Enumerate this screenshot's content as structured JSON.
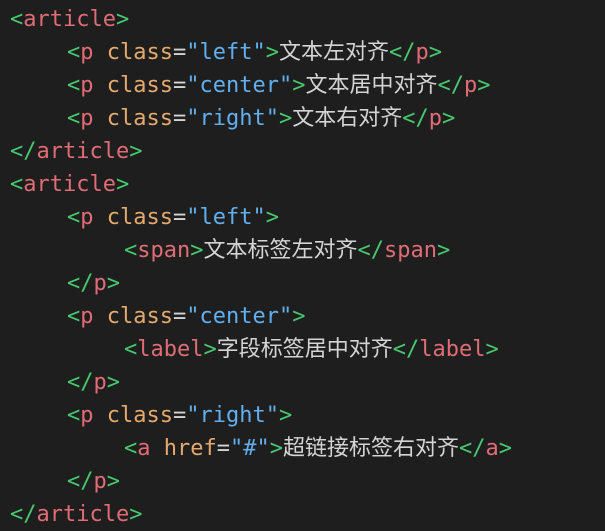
{
  "colors": {
    "background": "#1e1e1e",
    "bracket": "#47c96e",
    "tag_name": "#e06c75",
    "attribute": "#e5a96b",
    "string": "#61afef",
    "text": "#d4d4d4"
  },
  "lines": [
    {
      "indent": 0,
      "tokens": [
        {
          "type": "punct",
          "text": "<"
        },
        {
          "type": "tag",
          "text": "article"
        },
        {
          "type": "punct",
          "text": ">"
        }
      ]
    },
    {
      "indent": 1,
      "tokens": [
        {
          "type": "punct",
          "text": "<"
        },
        {
          "type": "tag",
          "text": "p"
        },
        {
          "type": "text",
          "text": " "
        },
        {
          "type": "attr",
          "text": "class"
        },
        {
          "type": "eq",
          "text": "="
        },
        {
          "type": "str",
          "text": "\"left\""
        },
        {
          "type": "punct",
          "text": ">"
        },
        {
          "type": "text",
          "text": "文本左对齐"
        },
        {
          "type": "punct",
          "text": "</"
        },
        {
          "type": "tag",
          "text": "p"
        },
        {
          "type": "punct",
          "text": ">"
        }
      ]
    },
    {
      "indent": 1,
      "tokens": [
        {
          "type": "punct",
          "text": "<"
        },
        {
          "type": "tag",
          "text": "p"
        },
        {
          "type": "text",
          "text": " "
        },
        {
          "type": "attr",
          "text": "class"
        },
        {
          "type": "eq",
          "text": "="
        },
        {
          "type": "str",
          "text": "\"center\""
        },
        {
          "type": "punct",
          "text": ">"
        },
        {
          "type": "text",
          "text": "文本居中对齐"
        },
        {
          "type": "punct",
          "text": "</"
        },
        {
          "type": "tag",
          "text": "p"
        },
        {
          "type": "punct",
          "text": ">"
        }
      ]
    },
    {
      "indent": 1,
      "tokens": [
        {
          "type": "punct",
          "text": "<"
        },
        {
          "type": "tag",
          "text": "p"
        },
        {
          "type": "text",
          "text": " "
        },
        {
          "type": "attr",
          "text": "class"
        },
        {
          "type": "eq",
          "text": "="
        },
        {
          "type": "str",
          "text": "\"right\""
        },
        {
          "type": "punct",
          "text": ">"
        },
        {
          "type": "text",
          "text": "文本右对齐"
        },
        {
          "type": "punct",
          "text": "</"
        },
        {
          "type": "tag",
          "text": "p"
        },
        {
          "type": "punct",
          "text": ">"
        }
      ]
    },
    {
      "indent": 0,
      "tokens": [
        {
          "type": "punct",
          "text": "</"
        },
        {
          "type": "tag",
          "text": "article"
        },
        {
          "type": "punct",
          "text": ">"
        }
      ]
    },
    {
      "indent": 0,
      "tokens": [
        {
          "type": "punct",
          "text": "<"
        },
        {
          "type": "tag",
          "text": "article"
        },
        {
          "type": "punct",
          "text": ">"
        }
      ]
    },
    {
      "indent": 1,
      "tokens": [
        {
          "type": "punct",
          "text": "<"
        },
        {
          "type": "tag",
          "text": "p"
        },
        {
          "type": "text",
          "text": " "
        },
        {
          "type": "attr",
          "text": "class"
        },
        {
          "type": "eq",
          "text": "="
        },
        {
          "type": "str",
          "text": "\"left\""
        },
        {
          "type": "punct",
          "text": ">"
        }
      ]
    },
    {
      "indent": 2,
      "tokens": [
        {
          "type": "punct",
          "text": "<"
        },
        {
          "type": "tag",
          "text": "span"
        },
        {
          "type": "punct",
          "text": ">"
        },
        {
          "type": "text",
          "text": "文本标签左对齐"
        },
        {
          "type": "punct",
          "text": "</"
        },
        {
          "type": "tag",
          "text": "span"
        },
        {
          "type": "punct",
          "text": ">"
        }
      ]
    },
    {
      "indent": 1,
      "tokens": [
        {
          "type": "punct",
          "text": "</"
        },
        {
          "type": "tag",
          "text": "p"
        },
        {
          "type": "punct",
          "text": ">"
        }
      ]
    },
    {
      "indent": 1,
      "tokens": [
        {
          "type": "punct",
          "text": "<"
        },
        {
          "type": "tag",
          "text": "p"
        },
        {
          "type": "text",
          "text": " "
        },
        {
          "type": "attr",
          "text": "class"
        },
        {
          "type": "eq",
          "text": "="
        },
        {
          "type": "str",
          "text": "\"center\""
        },
        {
          "type": "punct",
          "text": ">"
        }
      ]
    },
    {
      "indent": 2,
      "tokens": [
        {
          "type": "punct",
          "text": "<"
        },
        {
          "type": "tag",
          "text": "label"
        },
        {
          "type": "punct",
          "text": ">"
        },
        {
          "type": "text",
          "text": "字段标签居中对齐"
        },
        {
          "type": "punct",
          "text": "</"
        },
        {
          "type": "tag",
          "text": "label"
        },
        {
          "type": "punct",
          "text": ">"
        }
      ]
    },
    {
      "indent": 1,
      "tokens": [
        {
          "type": "punct",
          "text": "</"
        },
        {
          "type": "tag",
          "text": "p"
        },
        {
          "type": "punct",
          "text": ">"
        }
      ]
    },
    {
      "indent": 1,
      "tokens": [
        {
          "type": "punct",
          "text": "<"
        },
        {
          "type": "tag",
          "text": "p"
        },
        {
          "type": "text",
          "text": " "
        },
        {
          "type": "attr",
          "text": "class"
        },
        {
          "type": "eq",
          "text": "="
        },
        {
          "type": "str",
          "text": "\"right\""
        },
        {
          "type": "punct",
          "text": ">"
        }
      ]
    },
    {
      "indent": 2,
      "tokens": [
        {
          "type": "punct",
          "text": "<"
        },
        {
          "type": "tag",
          "text": "a"
        },
        {
          "type": "text",
          "text": " "
        },
        {
          "type": "attr",
          "text": "href"
        },
        {
          "type": "eq",
          "text": "="
        },
        {
          "type": "str",
          "text": "\"#\""
        },
        {
          "type": "punct",
          "text": ">"
        },
        {
          "type": "text",
          "text": "超链接标签右对齐"
        },
        {
          "type": "punct",
          "text": "</"
        },
        {
          "type": "tag",
          "text": "a"
        },
        {
          "type": "punct",
          "text": ">"
        }
      ]
    },
    {
      "indent": 1,
      "tokens": [
        {
          "type": "punct",
          "text": "</"
        },
        {
          "type": "tag",
          "text": "p"
        },
        {
          "type": "punct",
          "text": ">"
        }
      ]
    },
    {
      "indent": 0,
      "tokens": [
        {
          "type": "punct",
          "text": "</"
        },
        {
          "type": "tag",
          "text": "article"
        },
        {
          "type": "punct",
          "text": ">"
        }
      ]
    }
  ]
}
